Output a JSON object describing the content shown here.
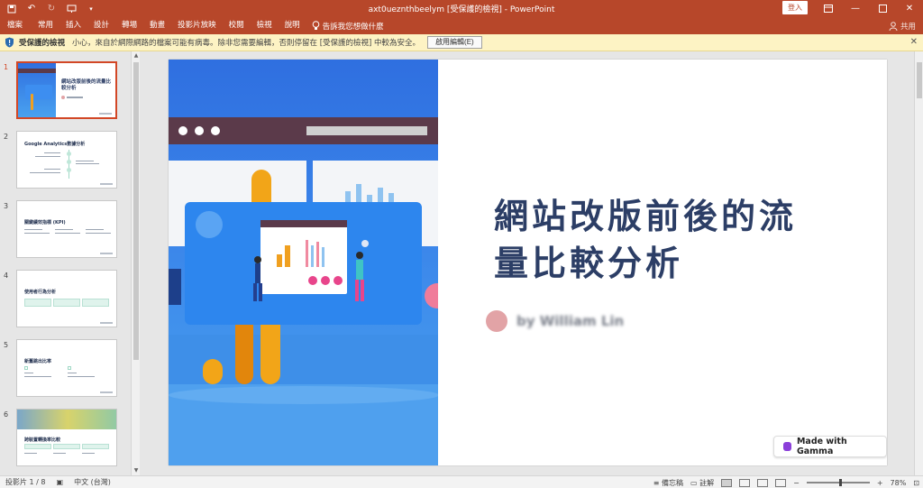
{
  "window": {
    "title": "axt0ueznthbeelym [受保護的檢視] - PowerPoint",
    "signin_label": "登入",
    "controls": [
      "ribbon-display-icon",
      "minimize-icon",
      "maximize-icon",
      "close-icon"
    ]
  },
  "qat": [
    "save-icon",
    "undo-icon",
    "redo-icon",
    "present-icon"
  ],
  "ribbon": {
    "tabs": [
      "檔案",
      "常用",
      "插入",
      "設計",
      "轉場",
      "動畫",
      "投影片放映",
      "校閱",
      "檢視",
      "說明"
    ],
    "tellme": "告訴我您想做什麼",
    "share": "共用"
  },
  "protected_view": {
    "title": "受保護的檢視",
    "message": "小心，來自於網際網路的檔案可能有病毒。除非您需要編輯，否則停留在 [受保護的檢視] 中較為安全。",
    "button": "啟用編輯(E)"
  },
  "thumbnails": [
    {
      "number": "1",
      "title": "網站改版前後的流量比較分析"
    },
    {
      "number": "2",
      "title": "Google Analytics數據分析"
    },
    {
      "number": "3",
      "title": "關鍵績效指標 (KPI)"
    },
    {
      "number": "4",
      "title": "使用者行為分析"
    },
    {
      "number": "5",
      "title": "新舊跳出比率"
    },
    {
      "number": "6",
      "title": "跨裝置轉換率比較"
    }
  ],
  "slide": {
    "title_line1": "網站改版前後的流",
    "title_line2": "量比較分析",
    "author": "by William Lin",
    "badge": "Made with Gamma"
  },
  "status": {
    "slide_indicator": "投影片 1 / 8",
    "language": "中文 (台灣)",
    "notes": "備忘稿",
    "comments": "註解",
    "zoom": "78%"
  },
  "colors": {
    "ribbon": "#b7472a",
    "protected_bar": "#fdf3c4",
    "title_text": "#2c3e66",
    "selection": "#d24726"
  }
}
